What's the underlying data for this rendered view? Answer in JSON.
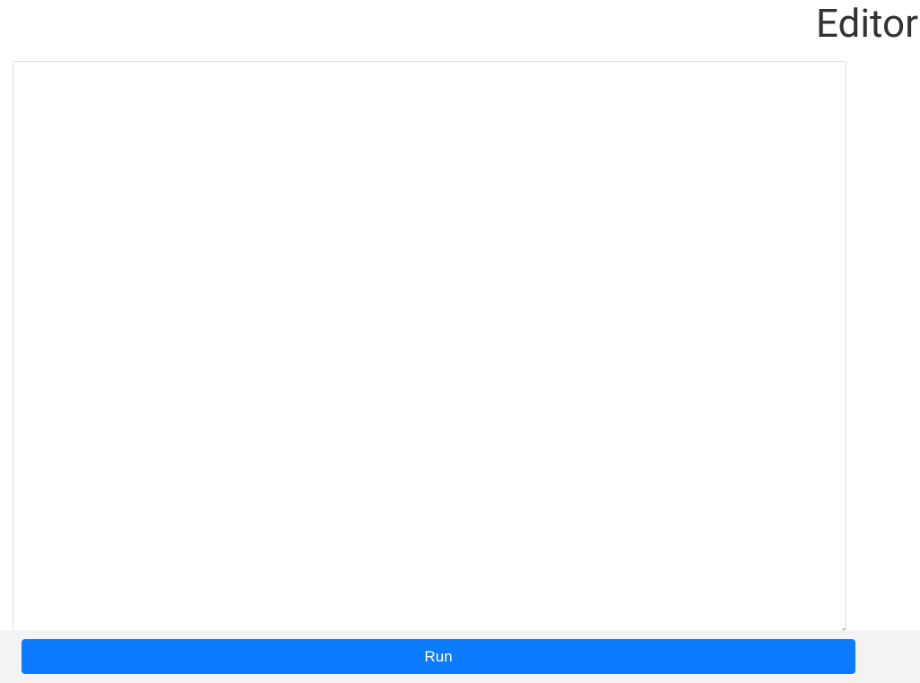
{
  "header": {
    "title": "Editor"
  },
  "editor": {
    "value": "",
    "placeholder": ""
  },
  "footer": {
    "run_label": "Run"
  }
}
